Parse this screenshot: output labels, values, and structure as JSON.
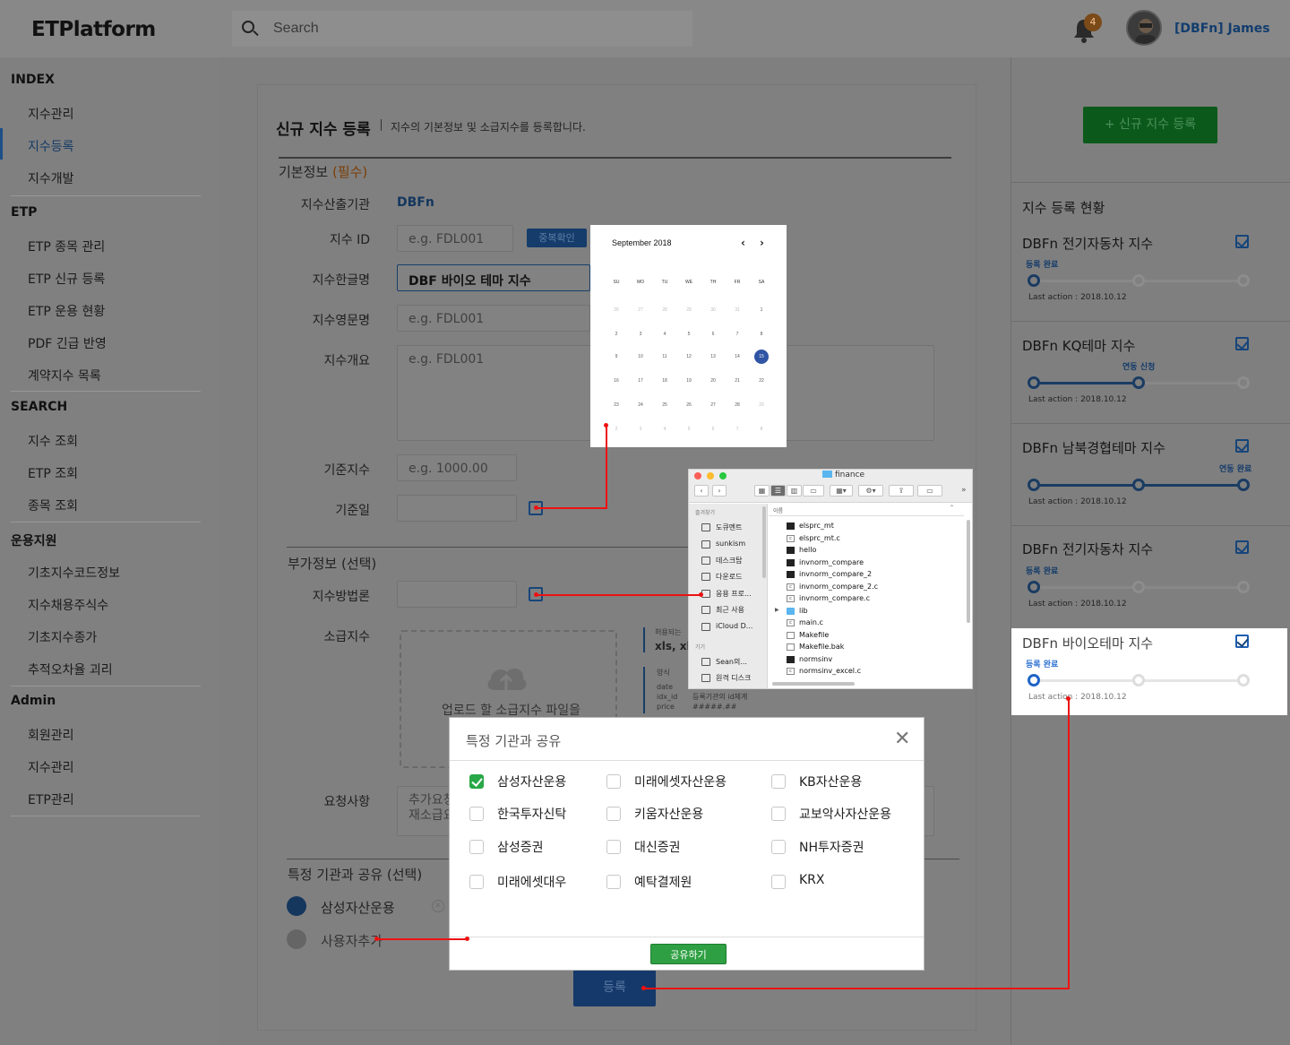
{
  "header": {
    "logo": "ETPlatform",
    "search_placeholder": "Search",
    "notification_count": "4",
    "user_name": "[DBFn] James"
  },
  "sidebar": {
    "sections": [
      {
        "title": "INDEX",
        "items": [
          "지수관리",
          "지수등록",
          "지수개발"
        ]
      },
      {
        "title": "ETP",
        "items": [
          "ETP 종목 관리",
          "ETP 신규 등록",
          "ETP 운용 현황",
          "PDF 긴급 반영",
          "계약지수 목록"
        ]
      },
      {
        "title": "SEARCH",
        "items": [
          "지수 조회",
          "ETP 조회",
          "종목 조회"
        ]
      },
      {
        "title": "운용지원",
        "items": [
          "기초지수코드정보",
          "지수채용주식수",
          "기초지수종가",
          "추적오차율 괴리"
        ]
      },
      {
        "title": "Admin",
        "items": [
          "회원관리",
          "지수관리",
          "ETP관리"
        ]
      }
    ],
    "active_item": "지수등록"
  },
  "form": {
    "title": "신규 지수 등록",
    "subtitle": "지수의 기본정보 및 소급지수를 등록합니다.",
    "basic_section": "기본정보",
    "basic_required": "(필수)",
    "fields": {
      "institution_label": "지수산출기관",
      "institution_value": "DBFn",
      "id_label": "지수 ID",
      "id_placeholder": "e.g. FDL001",
      "dup_check": "중복확인",
      "kor_name_label": "지수한글명",
      "kor_name_value": "DBF 바이오 테마 지수",
      "eng_name_label": "지수영문명",
      "eng_name_placeholder": "e.g. FDL001",
      "summary_label": "지수개요",
      "summary_placeholder": "e.g. FDL001",
      "base_index_label": "기준지수",
      "base_index_placeholder": "e.g. 1000.00",
      "base_date_label": "기준일"
    },
    "extra_section": "부가정보 (선택)",
    "extra": {
      "method_label": "지수방법론",
      "backfill_label": "소급지수",
      "upload_text": "업로드 할 소급지수 파일을",
      "allowed_label": "허용되는",
      "allowed_ext": "xls, xls",
      "format_label": "양식",
      "format_fields": [
        "date",
        "idx_id",
        "price"
      ],
      "format_notes": [
        "등록기관의 id체계",
        "#####.##"
      ],
      "request_label": "요청사항",
      "request_placeholder_1": "추가요청",
      "request_placeholder_2": "재소급요"
    },
    "share_section": "특정 기관과 공유 (선택)",
    "shared_with": "삼성자산운용",
    "add_user": "사용자추가",
    "submit": "등록"
  },
  "right_panel": {
    "new_button": "+ 신규 지수 등록",
    "status_title": "지수 등록 현황",
    "cards": [
      {
        "name": "DBFn 전기자동차 지수",
        "stage": "등록 완료",
        "progress": 0,
        "last_action": "Last action : 2018.10.12"
      },
      {
        "name": "DBFn KQ테마 지수",
        "stage": "연동 신청",
        "progress": 0.5,
        "last_action": "Last action : 2018.10.12"
      },
      {
        "name": "DBFn 남북경협테마 지수",
        "stage": "연동 완료",
        "progress": 1,
        "last_action": "Last action : 2018.10.12"
      },
      {
        "name": "DBFn 전기자동차 지수",
        "stage": "등록 완료",
        "progress": 0,
        "last_action": "Last action : 2018.10.12"
      },
      {
        "name": "DBFn 바이오테마 지수",
        "stage": "등록 완료",
        "progress": 0,
        "last_action": "Last action : 2018.10.12"
      }
    ]
  },
  "calendar": {
    "month": "September 2018",
    "prev": "‹",
    "next": "›",
    "dow": [
      "SU",
      "MO",
      "TU",
      "WE",
      "TH",
      "FR",
      "SA"
    ],
    "weeks": [
      [
        "26",
        "27",
        "28",
        "29",
        "30",
        "31",
        "1"
      ],
      [
        "2",
        "3",
        "4",
        "5",
        "6",
        "7",
        "8"
      ],
      [
        "9",
        "10",
        "11",
        "12",
        "13",
        "14",
        "15"
      ],
      [
        "16",
        "17",
        "18",
        "19",
        "20",
        "21",
        "22"
      ],
      [
        "23",
        "24",
        "25",
        "26",
        "27",
        "28",
        "29"
      ],
      [
        "2",
        "3",
        "4",
        "5",
        "6",
        "7",
        "8"
      ]
    ],
    "selected": "15"
  },
  "finder": {
    "title": "finance",
    "favorites_label": "즐겨찾기",
    "favorites": [
      "도큐멘트",
      "sunkism",
      "데스크탑",
      "다운로드",
      "응용 프로...",
      "최근 사용",
      "iCloud D..."
    ],
    "devices_label": "기기",
    "devices": [
      "Sean의...",
      "원격 디스크"
    ],
    "column_header": "이름",
    "files": [
      {
        "name": "elsprc_mt",
        "kind": "exec"
      },
      {
        "name": "elsprc_mt.c",
        "kind": "c"
      },
      {
        "name": "hello",
        "kind": "exec"
      },
      {
        "name": "invnorm_compare",
        "kind": "exec"
      },
      {
        "name": "invnorm_compare_2",
        "kind": "exec"
      },
      {
        "name": "invnorm_compare_2.c",
        "kind": "c"
      },
      {
        "name": "invnorm_compare.c",
        "kind": "c"
      },
      {
        "name": "lib",
        "kind": "folder"
      },
      {
        "name": "main.c",
        "kind": "c"
      },
      {
        "name": "Makefile",
        "kind": "plain"
      },
      {
        "name": "Makefile.bak",
        "kind": "plain"
      },
      {
        "name": "normsinv",
        "kind": "exec"
      },
      {
        "name": "normsinv_excel.c",
        "kind": "c"
      }
    ]
  },
  "modal": {
    "title": "특정 기관과 공유",
    "close": "✕",
    "options": [
      {
        "label": "삼성자산운용",
        "checked": true
      },
      {
        "label": "미래에셋자산운용",
        "checked": false
      },
      {
        "label": "KB자산운용",
        "checked": false
      },
      {
        "label": "한국투자신탁",
        "checked": false
      },
      {
        "label": "키움자산운용",
        "checked": false
      },
      {
        "label": "교보악사자산운용",
        "checked": false
      },
      {
        "label": "삼성증권",
        "checked": false
      },
      {
        "label": "대신증권",
        "checked": false
      },
      {
        "label": "NH투자증권",
        "checked": false
      },
      {
        "label": "미래에셋대우",
        "checked": false
      },
      {
        "label": "예탁결제원",
        "checked": false
      },
      {
        "label": "KRX",
        "checked": false
      }
    ],
    "share_button": "공유하기"
  }
}
